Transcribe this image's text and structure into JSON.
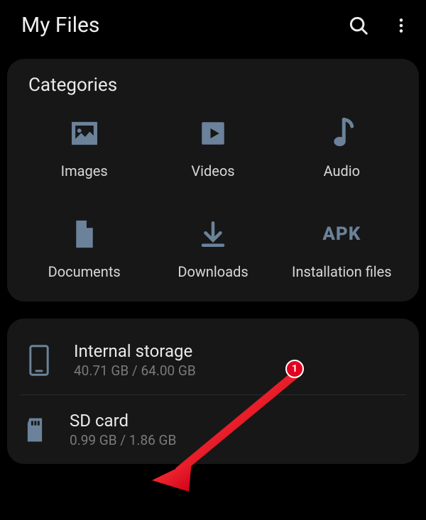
{
  "header": {
    "title": "My Files"
  },
  "categories": {
    "title": "Categories",
    "items": [
      {
        "label": "Images"
      },
      {
        "label": "Videos"
      },
      {
        "label": "Audio"
      },
      {
        "label": "Documents"
      },
      {
        "label": "Downloads"
      },
      {
        "label": "Installation files",
        "apk_text": "APK"
      }
    ]
  },
  "storage": {
    "internal": {
      "title": "Internal storage",
      "sub": "40.71 GB / 64.00 GB"
    },
    "sdcard": {
      "title": "SD card",
      "sub": "0.99 GB / 1.86 GB"
    }
  },
  "annotation": {
    "badge": "1"
  }
}
